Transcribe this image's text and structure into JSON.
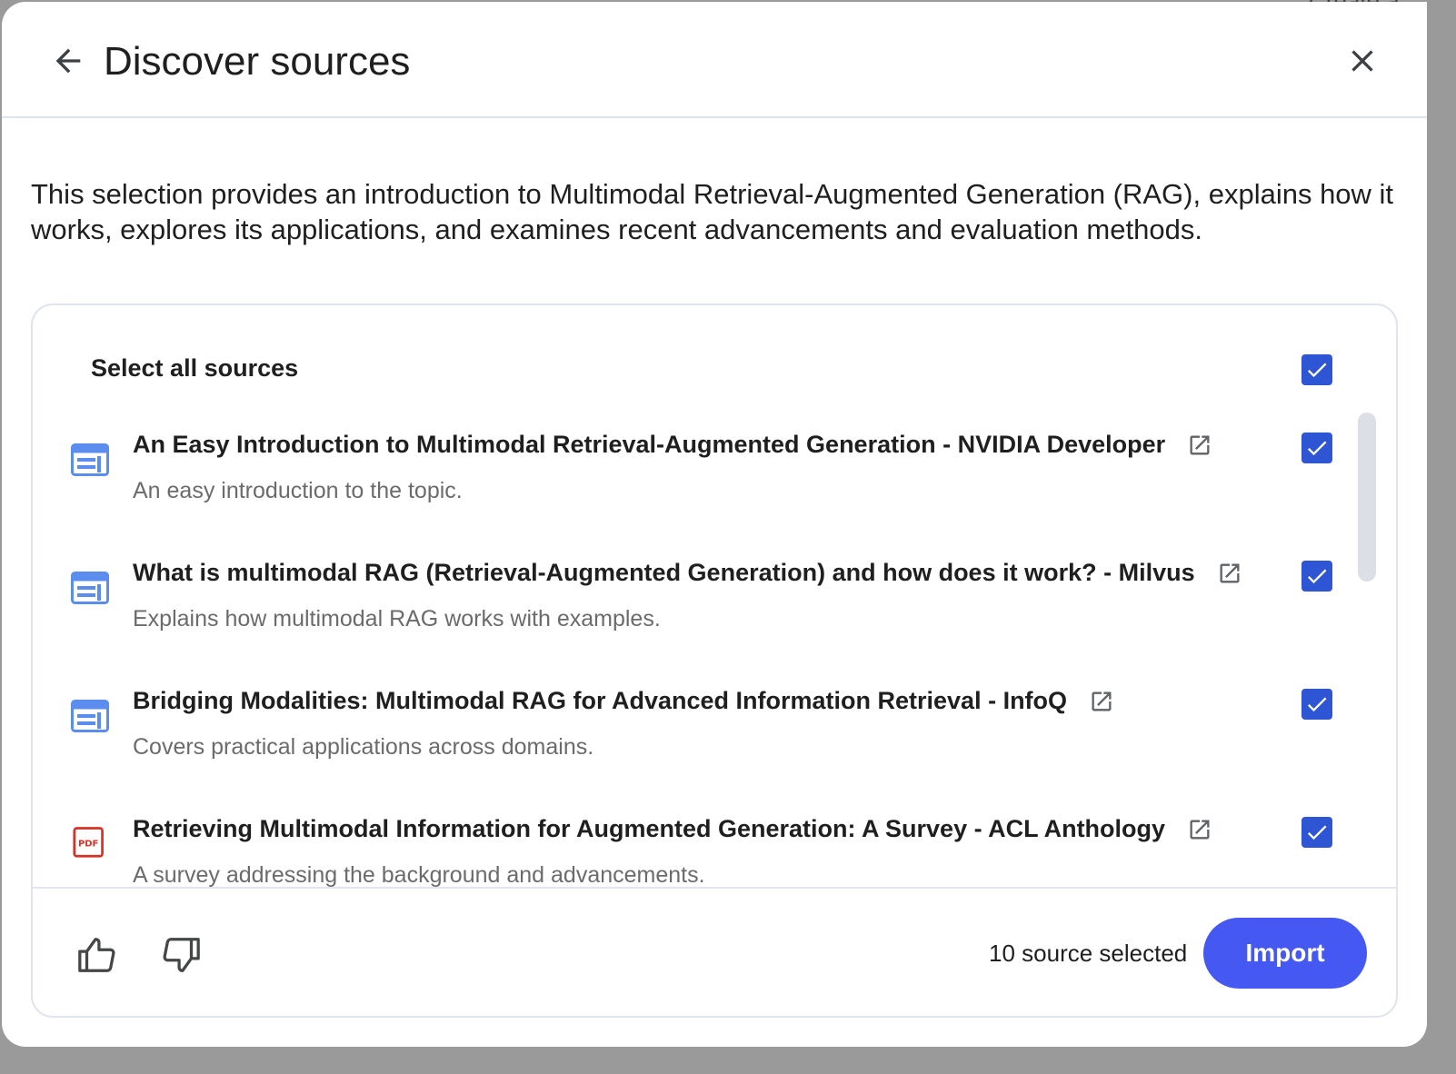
{
  "background": {
    "peek_text": "Create a"
  },
  "dialog": {
    "title": "Discover sources",
    "summary": "This selection provides an introduction to Multimodal Retrieval-Augmented Generation (RAG), explains how it works, explores its applications, and examines recent advancements and evaluation methods."
  },
  "panel": {
    "select_all_label": "Select all sources",
    "select_all_checked": true,
    "items": [
      {
        "icon": "web-page-icon",
        "title": "An Easy Introduction to Multimodal Retrieval-Augmented Generation - NVIDIA Developer",
        "description": "An easy introduction to the topic.",
        "checked": true
      },
      {
        "icon": "web-page-icon",
        "title": "What is multimodal RAG (Retrieval-Augmented Generation) and how does it work? - Milvus",
        "description": "Explains how multimodal RAG works with examples.",
        "checked": true
      },
      {
        "icon": "web-page-icon",
        "title": "Bridging Modalities: Multimodal RAG for Advanced Information Retrieval - InfoQ",
        "description": "Covers practical applications across domains.",
        "checked": true
      },
      {
        "icon": "pdf-icon",
        "pdf_label": "PDF",
        "title": "Retrieving Multimodal Information for Augmented Generation: A Survey - ACL Anthology",
        "description": "A survey addressing the background and advancements.",
        "checked": true
      }
    ]
  },
  "footer": {
    "selected_text": "10 source selected",
    "import_label": "Import"
  },
  "colors": {
    "accent": "#4559f2",
    "checkbox": "#2d55d4",
    "web_icon": "#5b8def",
    "pdf_icon": "#d93025"
  }
}
